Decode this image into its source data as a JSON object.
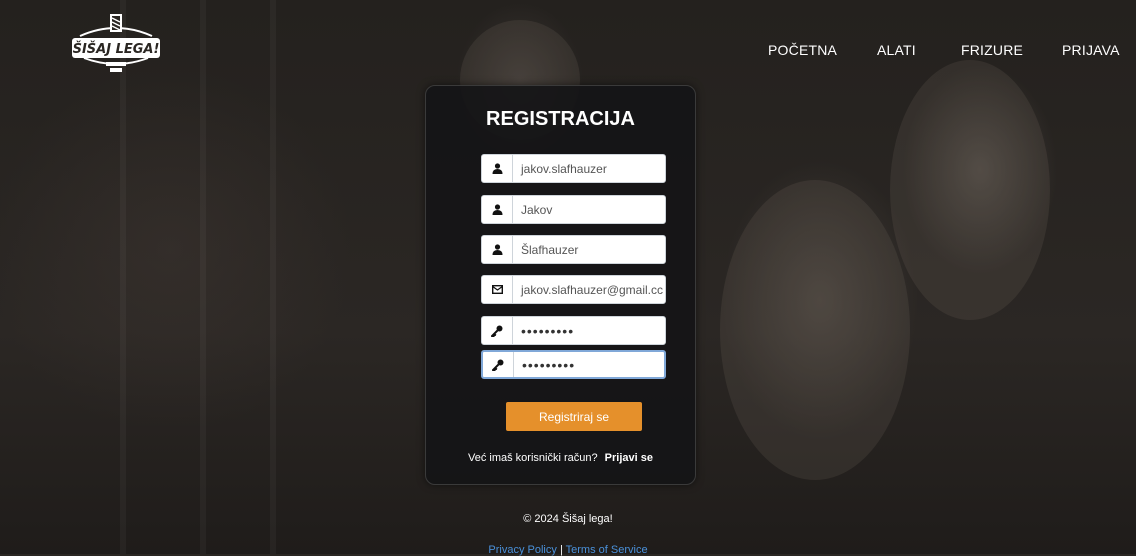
{
  "brand": {
    "logo_text": "ŠIŠAJ LEGA!"
  },
  "nav": {
    "items": [
      {
        "label": "POČETNA"
      },
      {
        "label": "ALATI"
      },
      {
        "label": "FRIZURE"
      },
      {
        "label": "PRIJAVA"
      }
    ]
  },
  "form": {
    "title": "REGISTRACIJA",
    "fields": [
      {
        "icon": "user-icon",
        "value": "jakov.slafhauzer"
      },
      {
        "icon": "user-icon",
        "value": "Jakov"
      },
      {
        "icon": "user-icon",
        "value": "Šlafhauzer"
      },
      {
        "icon": "envelope-icon",
        "value": "jakov.slafhauzer@gmail.cc"
      },
      {
        "icon": "key-icon",
        "value": "•••••••••"
      },
      {
        "icon": "key-icon",
        "value": "•••••••••"
      }
    ],
    "submit_label": "Registriraj se",
    "login_prompt": "Već imaš korisnički račun?",
    "login_link": "Prijavi se"
  },
  "footer": {
    "copyright": "© 2024 Šišaj lega!",
    "privacy": "Privacy Policy",
    "separator": "|",
    "terms": "Terms of Service"
  },
  "colors": {
    "accent": "#e5902b",
    "link": "#4a90d9",
    "card": "#141416"
  }
}
